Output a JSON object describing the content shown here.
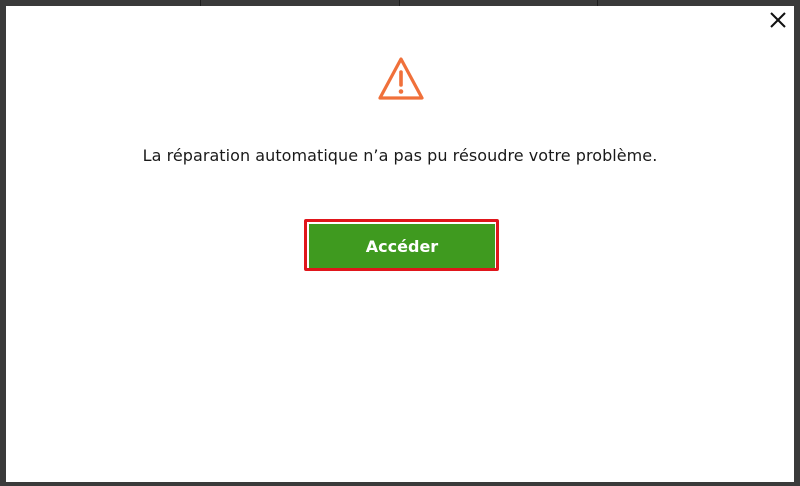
{
  "dialog": {
    "message": "La réparation automatique n’a pas pu résoudre votre problème.",
    "primary_button_label": "Accéder",
    "close_icon": "close-icon",
    "warning_icon": "warning-triangle-icon"
  },
  "colors": {
    "warning_icon": "#f0703a",
    "primary_button_bg": "#3f9a1f",
    "highlight_border": "#e0161b",
    "dialog_bg": "#ffffff"
  }
}
